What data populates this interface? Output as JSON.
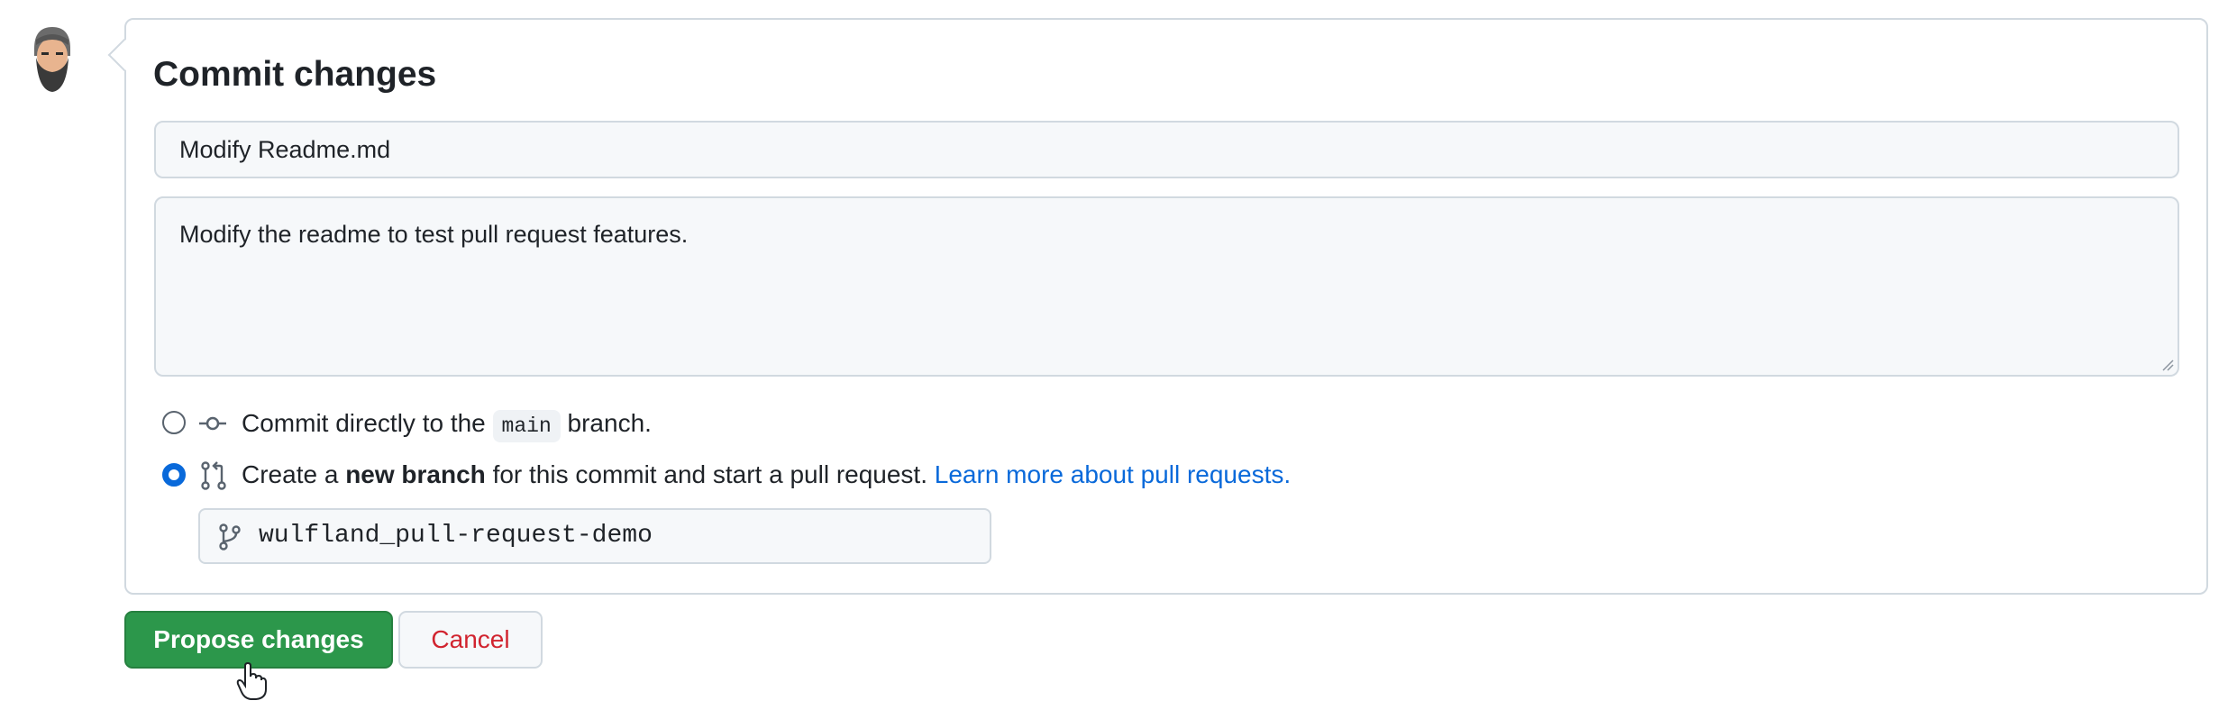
{
  "commit": {
    "title": "Commit changes",
    "summary_value": "Modify Readme.md",
    "description_value": "Modify the readme to test pull request features."
  },
  "options": {
    "direct": {
      "prefix": "Commit directly to the",
      "branch": "main",
      "suffix": "branch.",
      "selected": false
    },
    "new_branch": {
      "prefix": "Create a",
      "bold": "new branch",
      "suffix": "for this commit and start a pull request.",
      "link": "Learn more about pull requests.",
      "selected": true
    }
  },
  "branch_name": "wulfland_pull-request-demo",
  "buttons": {
    "propose": "Propose changes",
    "cancel": "Cancel"
  },
  "colors": {
    "primary": "#2c974b",
    "link": "#0969da",
    "danger": "#d1242f"
  }
}
